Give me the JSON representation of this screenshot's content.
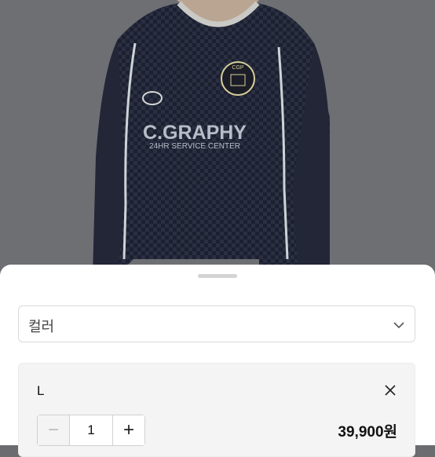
{
  "product": {
    "shirt_brand_text": "C.GRAPHY",
    "shirt_sub_text": "24HR SERVICE CENTER",
    "badge_text": "CGP"
  },
  "option_select": {
    "placeholder": "컬러"
  },
  "selected_option": {
    "size": "L",
    "quantity": "1",
    "minus": "−",
    "plus": "+",
    "price": "39,900원"
  },
  "colors": {
    "shirt": "#23283a",
    "backdrop": "#6e6f73",
    "sheet": "#ffffff"
  }
}
